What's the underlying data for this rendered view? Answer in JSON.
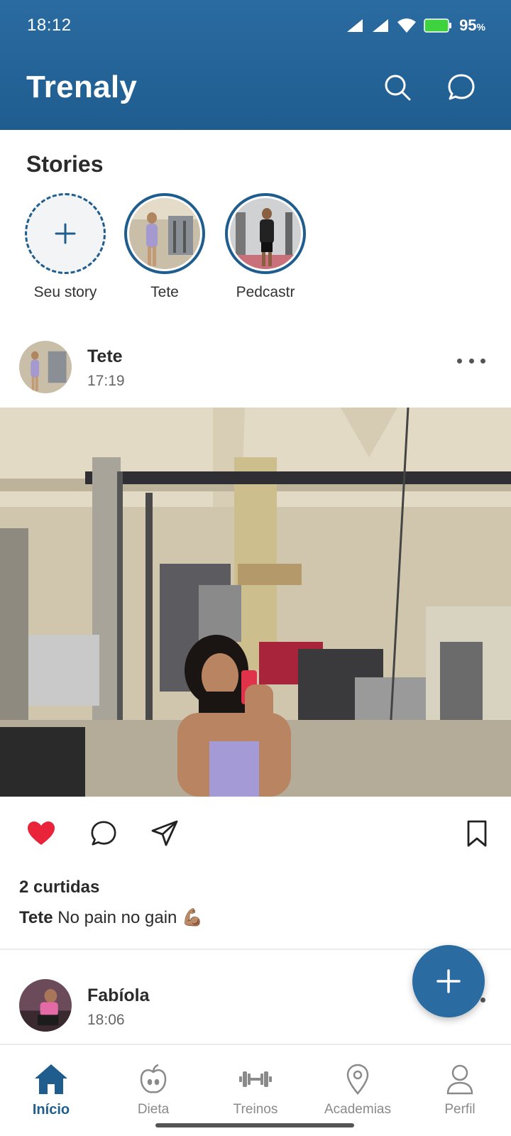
{
  "status_bar": {
    "time": "18:12",
    "battery": "95",
    "battery_unit": "%"
  },
  "header": {
    "title": "Trenaly"
  },
  "stories": {
    "title": "Stories",
    "items": [
      {
        "label": "Seu story"
      },
      {
        "label": "Tete"
      },
      {
        "label": "Pedcastr"
      }
    ]
  },
  "posts": [
    {
      "author": "Tete",
      "time": "17:19",
      "likes": "2 curtidas",
      "caption_author": "Tete",
      "caption_text": "No pain no gain 💪🏽",
      "liked": true
    },
    {
      "author": "Fabíola",
      "time": "18:06"
    }
  ],
  "nav": {
    "items": [
      {
        "label": "Início",
        "icon": "home-icon",
        "active": true
      },
      {
        "label": "Dieta",
        "icon": "apple-icon"
      },
      {
        "label": "Treinos",
        "icon": "dumbbell-icon"
      },
      {
        "label": "Academias",
        "icon": "location-pin-icon"
      },
      {
        "label": "Perfil",
        "icon": "person-icon"
      }
    ]
  },
  "colors": {
    "primary": "#1f5d8f",
    "like": "#e8233a"
  }
}
